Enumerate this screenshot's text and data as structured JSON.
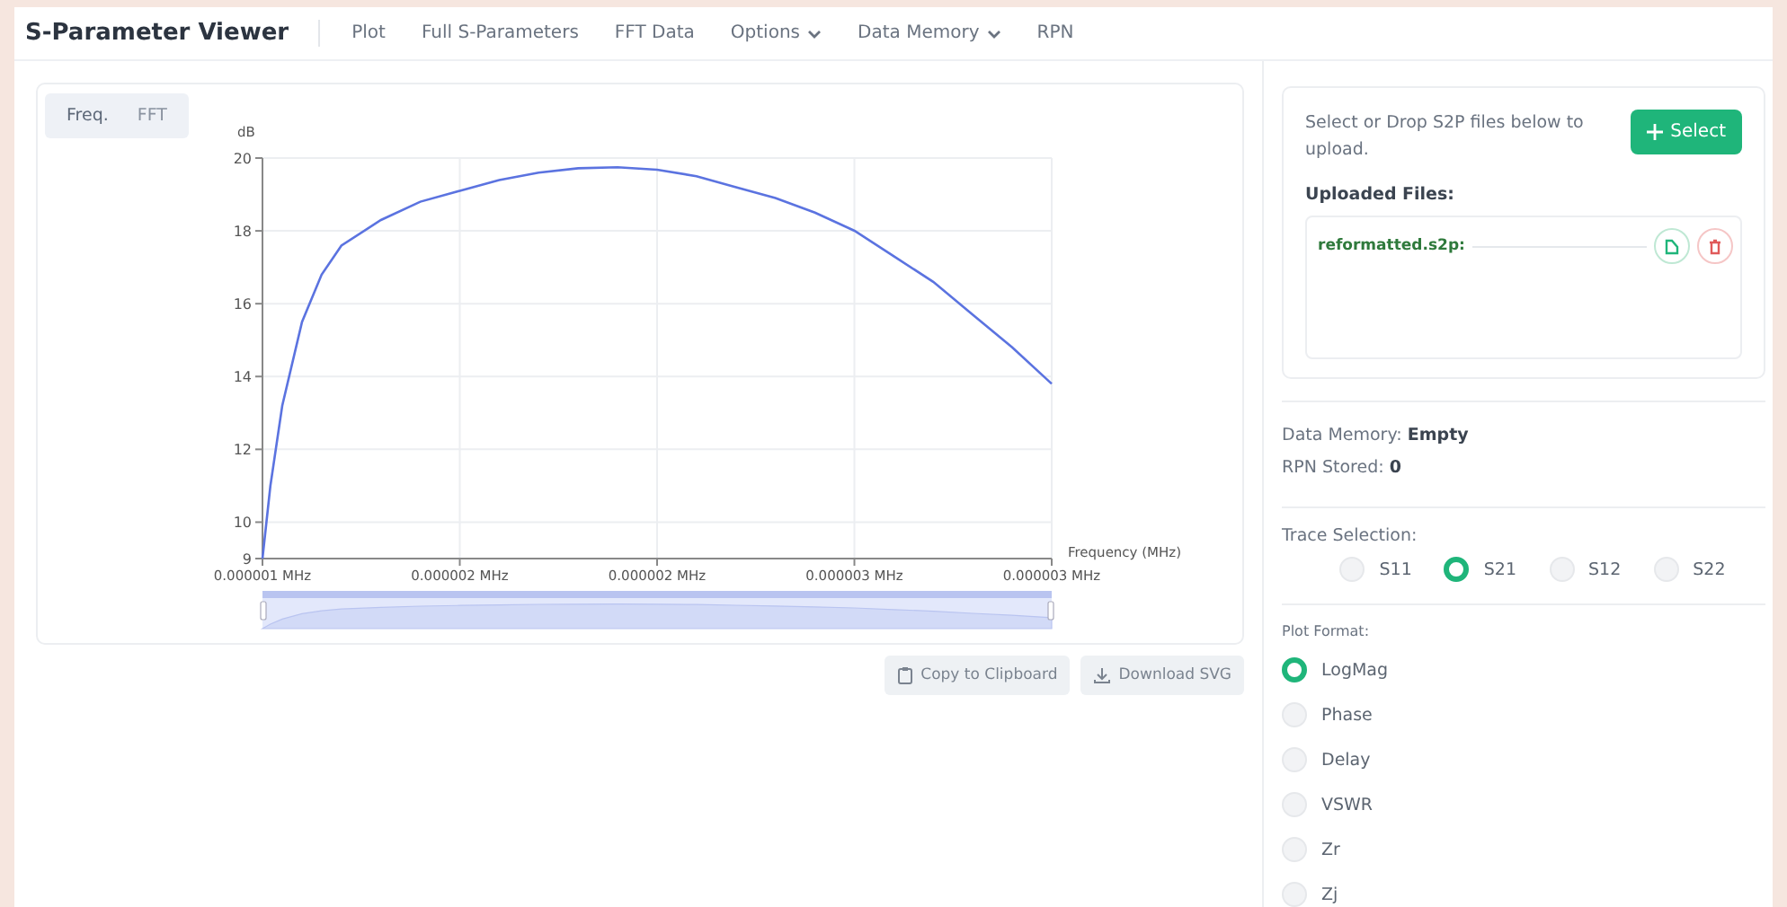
{
  "app": {
    "title": "S-Parameter Viewer"
  },
  "nav": [
    {
      "label": "Plot",
      "kind": "link"
    },
    {
      "label": "Full S-Parameters",
      "kind": "link"
    },
    {
      "label": "FFT Data",
      "kind": "link"
    },
    {
      "label": "Options",
      "kind": "dropdown"
    },
    {
      "label": "Data Memory",
      "kind": "dropdown"
    },
    {
      "label": "RPN",
      "kind": "link"
    }
  ],
  "view_tabs": [
    {
      "label": "Freq.",
      "selected": true
    },
    {
      "label": "FFT",
      "selected": false
    }
  ],
  "chart": {
    "chart_data": {
      "type": "line",
      "xlabel": "Frequency (MHz)",
      "ylabel": "dB",
      "x": [
        1e-06,
        1.02e-06,
        1.05e-06,
        1.1e-06,
        1.15e-06,
        1.2e-06,
        1.3e-06,
        1.4e-06,
        1.5e-06,
        1.6e-06,
        1.7e-06,
        1.8e-06,
        1.9e-06,
        2e-06,
        2.1e-06,
        2.2e-06,
        2.3e-06,
        2.4e-06,
        2.5e-06,
        2.6e-06,
        2.7e-06,
        2.8e-06,
        2.9e-06,
        3e-06
      ],
      "grid": true,
      "series": [
        {
          "color": "#5b73e0",
          "values": [
            9,
            11,
            13.2,
            15.5,
            16.8,
            17.6,
            18.3,
            18.8,
            19.1,
            19.4,
            19.6,
            19.72,
            19.75,
            19.68,
            19.5,
            19.2,
            18.9,
            18.5,
            18,
            17.3,
            16.6,
            15.7,
            14.8,
            13.8
          ]
        }
      ],
      "xlim": [
        1e-06,
        3e-06
      ],
      "ylim": [
        9,
        20
      ],
      "xticks": [
        {
          "value": 1e-06,
          "label": "0.000001 MHz"
        },
        {
          "value": 1.5e-06,
          "label": "0.000002 MHz"
        },
        {
          "value": 2e-06,
          "label": "0.000002 MHz"
        },
        {
          "value": 2.5e-06,
          "label": "0.000003 MHz"
        },
        {
          "value": 3e-06,
          "label": "0.000003 MHz"
        }
      ],
      "yticks": [
        9,
        10,
        12,
        14,
        16,
        18,
        20
      ]
    }
  },
  "chart_buttons": [
    {
      "label": "Copy to Clipboard",
      "kind": "copy"
    },
    {
      "label": "Download SVG",
      "kind": "download"
    }
  ],
  "upload": {
    "hint": "Select or Drop S2P files below to upload.",
    "button": "Select",
    "files_heading": "Uploaded Files:",
    "files": [
      {
        "name": "reformatted.s2p:"
      }
    ]
  },
  "status": [
    {
      "label": "Data Memory:",
      "value": "Empty"
    },
    {
      "label": "RPN Stored:",
      "value": "0"
    }
  ],
  "trace_selection": {
    "heading": "Trace Selection:",
    "options": [
      {
        "label": "S11",
        "selected": false
      },
      {
        "label": "S21",
        "selected": true
      },
      {
        "label": "S12",
        "selected": false
      },
      {
        "label": "S22",
        "selected": false
      }
    ]
  },
  "plot_format": {
    "heading": "Plot Format:",
    "options": [
      {
        "label": "LogMag",
        "selected": true
      },
      {
        "label": "Phase",
        "selected": false
      },
      {
        "label": "Delay",
        "selected": false
      },
      {
        "label": "VSWR",
        "selected": false
      },
      {
        "label": "Zr",
        "selected": false
      },
      {
        "label": "Zj",
        "selected": false
      }
    ]
  }
}
